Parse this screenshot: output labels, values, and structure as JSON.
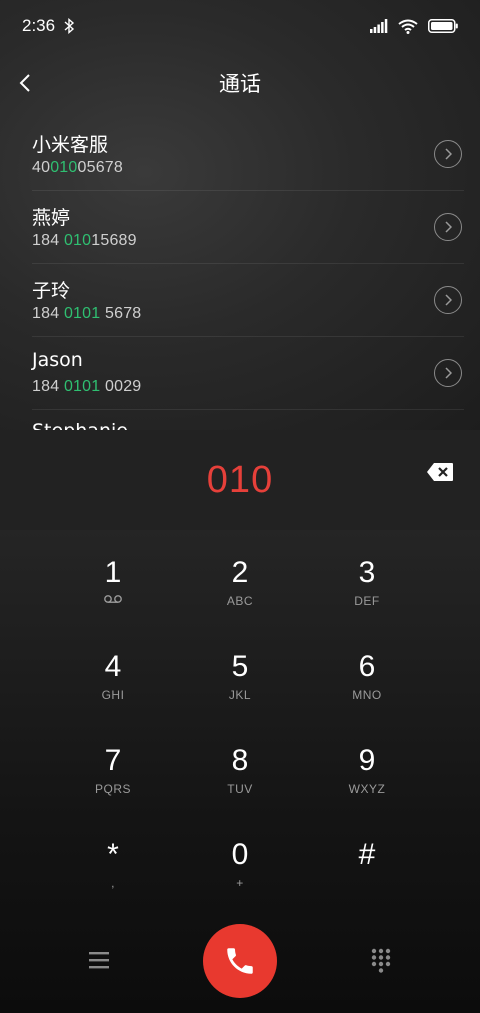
{
  "status_bar": {
    "time": "2:36"
  },
  "header": {
    "title": "通话"
  },
  "contacts": [
    {
      "name": "小米客服",
      "number_pre": "40",
      "number_hl": "010",
      "number_post": "05678"
    },
    {
      "name": "燕婷",
      "number_pre": "184 ",
      "number_hl": "010",
      "number_post": "15689"
    },
    {
      "name": "子玲",
      "number_pre": "184 ",
      "number_hl": "0101",
      "number_post": " 5678"
    },
    {
      "name": "Jason",
      "number_pre": "184 ",
      "number_hl": "0101",
      "number_post": " 0029"
    }
  ],
  "partial_contact": {
    "name": "Stephanie"
  },
  "dial": {
    "number": "010"
  },
  "keys": [
    {
      "digit": "1",
      "sub": ""
    },
    {
      "digit": "2",
      "sub": "ABC"
    },
    {
      "digit": "3",
      "sub": "DEF"
    },
    {
      "digit": "4",
      "sub": "GHI"
    },
    {
      "digit": "5",
      "sub": "JKL"
    },
    {
      "digit": "6",
      "sub": "MNO"
    },
    {
      "digit": "7",
      "sub": "PQRS"
    },
    {
      "digit": "8",
      "sub": "TUV"
    },
    {
      "digit": "9",
      "sub": "WXYZ"
    },
    {
      "digit": "*",
      "sub": ","
    },
    {
      "digit": "0",
      "sub": "+"
    },
    {
      "digit": "#",
      "sub": ""
    }
  ],
  "colors": {
    "accent_red": "#e6403a",
    "match_green": "#2fbf71",
    "call_button": "#e8392f"
  },
  "icons": {
    "back": "chevron-left-icon",
    "detail": "chevron-right-circle-icon",
    "delete": "backspace-icon",
    "voicemail": "voicemail-icon",
    "menu": "menu-icon",
    "call": "phone-icon",
    "dialpad": "dialpad-icon"
  }
}
